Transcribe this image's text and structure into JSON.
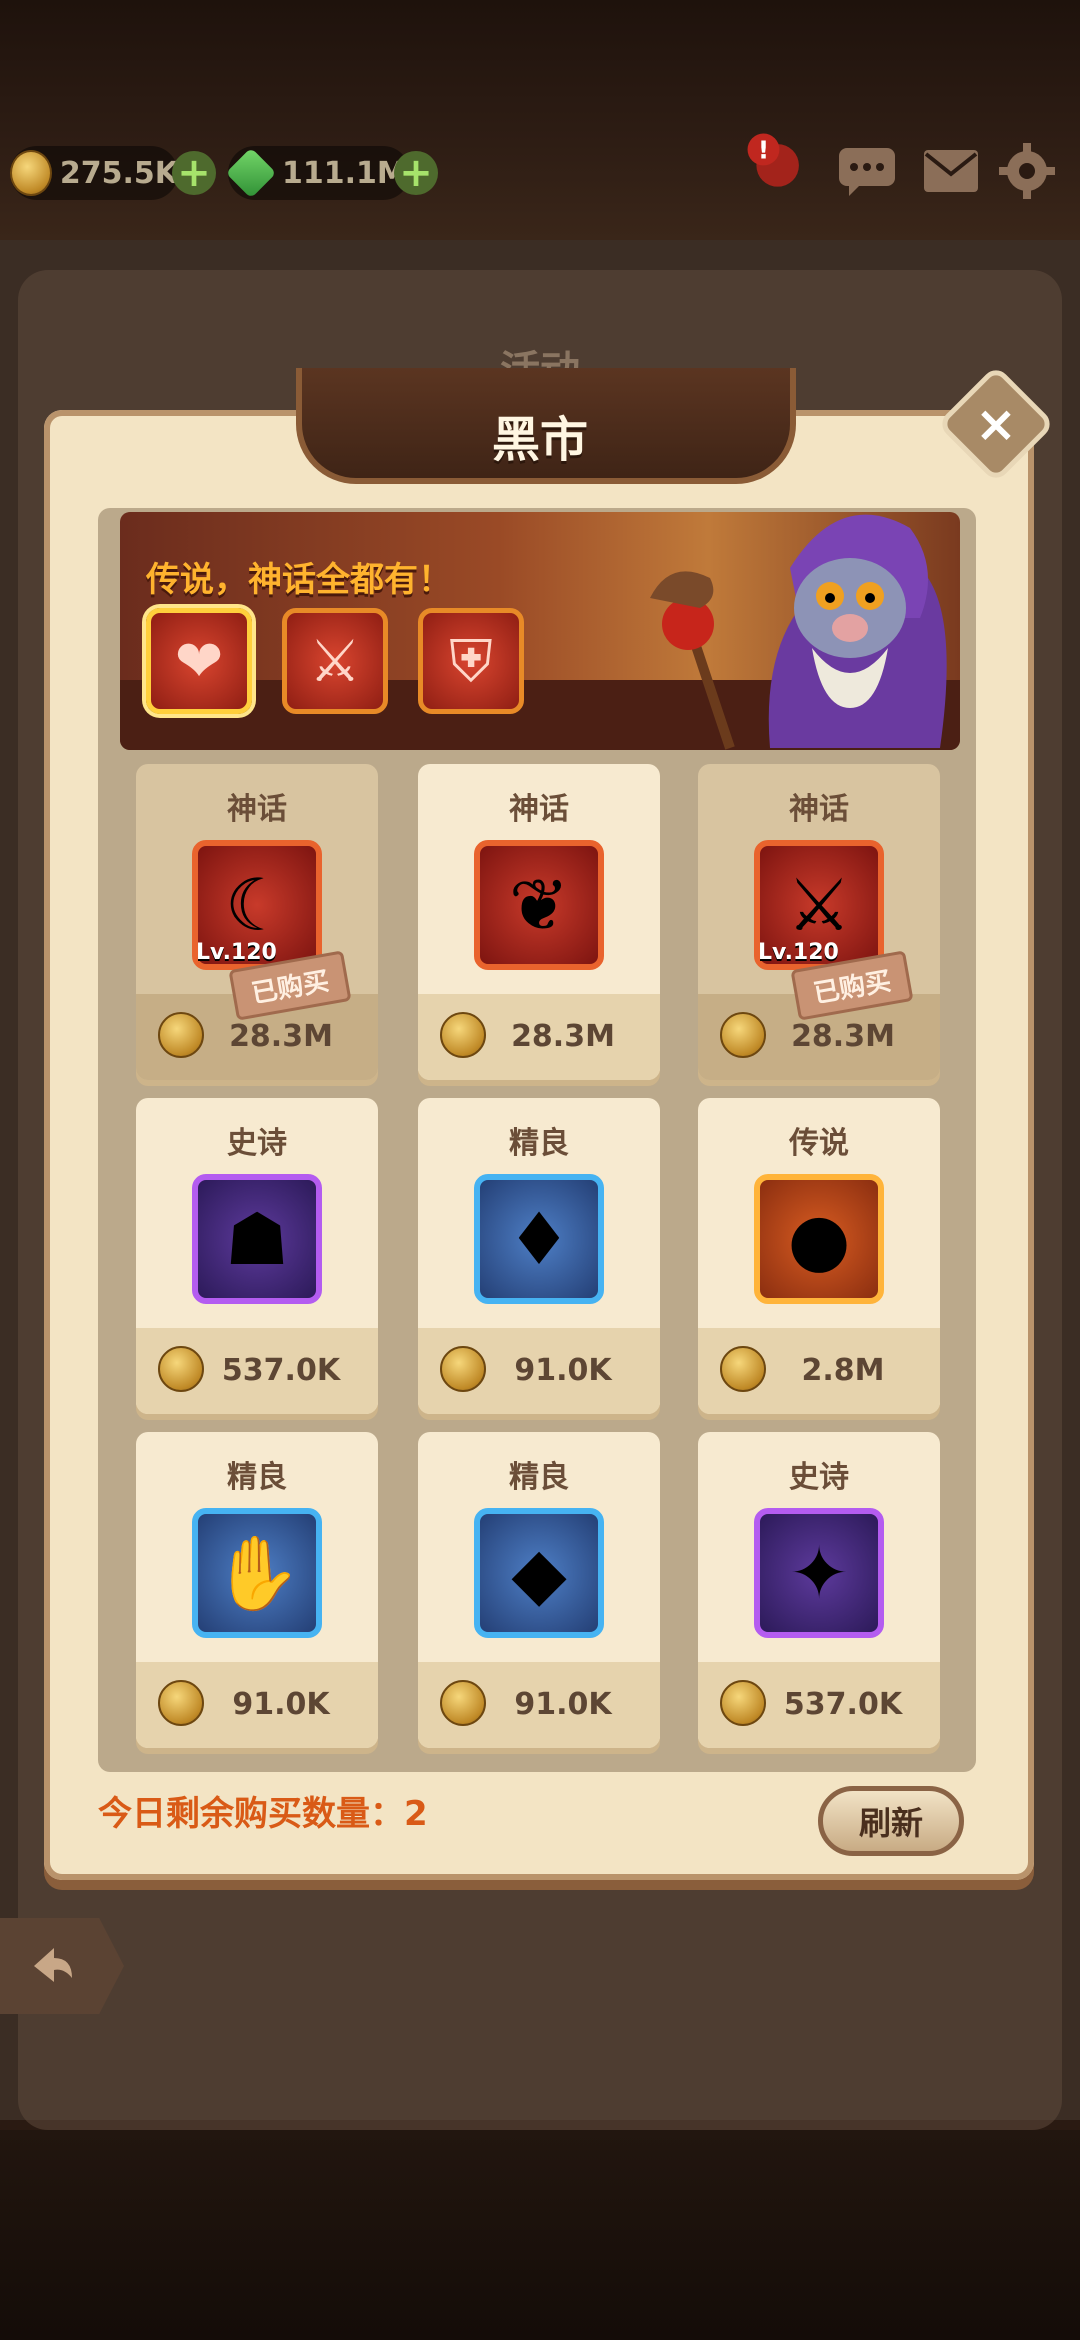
{
  "topbar": {
    "gold": "275.5K",
    "gems": "111.1M",
    "alert_mark": "!"
  },
  "dialog": {
    "background_tab": "活动",
    "title": "黑市",
    "close_symbol": "×"
  },
  "banner": {
    "text": "传说，神话全都有！",
    "items": [
      {
        "icon": "heart-scepter-icon",
        "glyph": "❤"
      },
      {
        "icon": "jeweled-sword-icon",
        "glyph": "⚔"
      },
      {
        "icon": "armor-icon",
        "glyph": "⛨"
      }
    ]
  },
  "shop": {
    "items": [
      {
        "rarity": "神话",
        "icon": "scythe-weapon-icon",
        "glyph": "☾",
        "level": "Lv.120",
        "price": "28.3M",
        "status": "已购买",
        "quality": "myth"
      },
      {
        "rarity": "神话",
        "icon": "winged-armor-icon",
        "glyph": "❦",
        "level": "",
        "price": "28.3M",
        "status": "",
        "quality": "myth"
      },
      {
        "rarity": "神话",
        "icon": "crimson-blade-icon",
        "glyph": "⚔",
        "level": "Lv.120",
        "price": "28.3M",
        "status": "已购买",
        "quality": "myth"
      },
      {
        "rarity": "史诗",
        "icon": "cape-icon",
        "glyph": "☗",
        "level": "",
        "price": "537.0K",
        "status": "",
        "quality": "epic"
      },
      {
        "rarity": "精良",
        "icon": "ruby-necklace-icon",
        "glyph": "♦",
        "level": "",
        "price": "91.0K",
        "status": "",
        "quality": "fine"
      },
      {
        "rarity": "传说",
        "icon": "green-orb-icon",
        "glyph": "●",
        "level": "",
        "price": "2.8M",
        "status": "",
        "quality": "leg"
      },
      {
        "rarity": "精良",
        "icon": "gauntlet-icon",
        "glyph": "✋",
        "level": "",
        "price": "91.0K",
        "status": "",
        "quality": "fine"
      },
      {
        "rarity": "精良",
        "icon": "pink-gem-amulet-icon",
        "glyph": "◆",
        "level": "",
        "price": "91.0K",
        "status": "",
        "quality": "fine"
      },
      {
        "rarity": "史诗",
        "icon": "silver-orb-icon",
        "glyph": "✦",
        "level": "",
        "price": "537.0K",
        "status": "",
        "quality": "epic"
      }
    ],
    "remaining": "今日剩余购买数量：2",
    "refresh_label": "刷新"
  },
  "colors": {
    "myth_border": "#e9632d",
    "epic_border": "#b45cf0",
    "fine_border": "#46b3f2",
    "legend_border": "#ffb43a",
    "banner_text": "#ffb32e",
    "remaining_text": "#d95a16"
  }
}
